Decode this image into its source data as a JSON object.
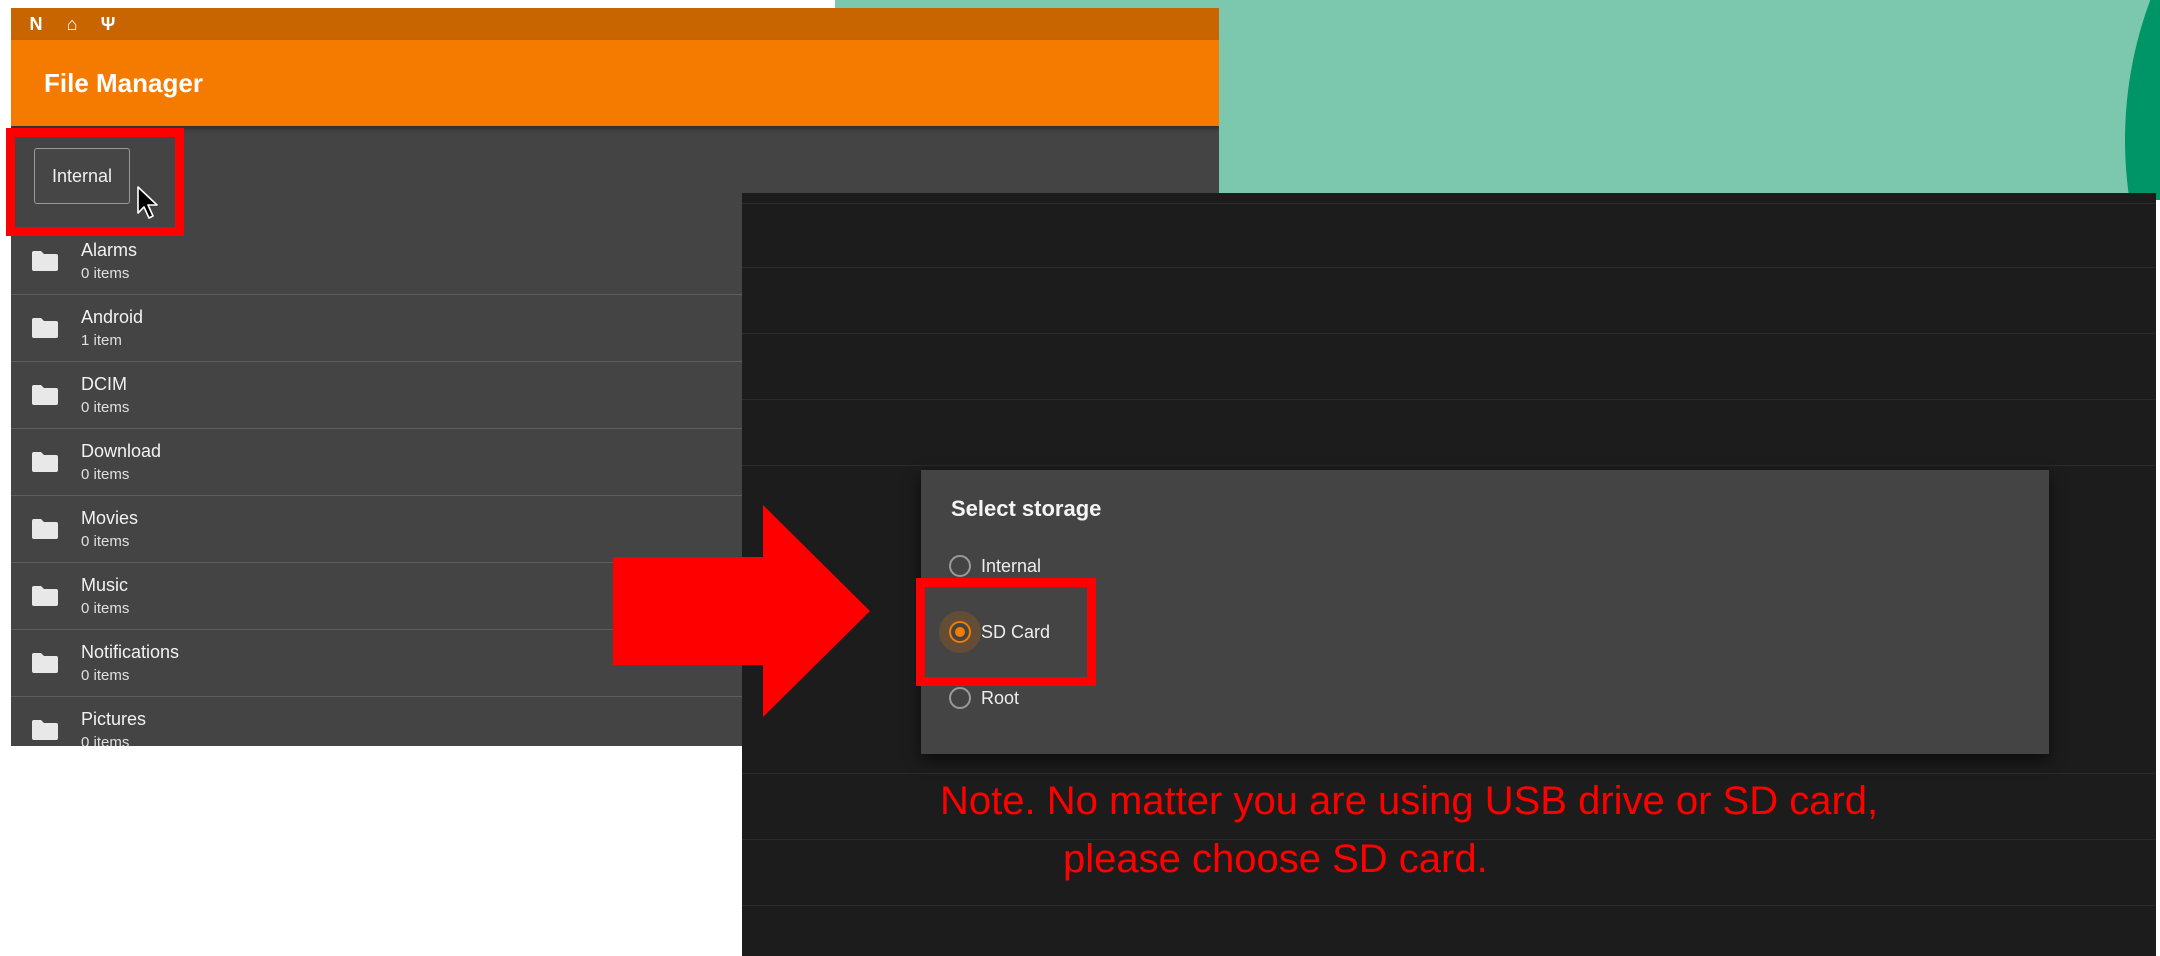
{
  "colors": {
    "statusbar": "#c96500",
    "appbar": "#f57b00",
    "panel": "#444444",
    "highlight": "#ff0000",
    "radio_accent": "#f57b00",
    "bg_light_green": "#7bc8ae",
    "bg_dark_green": "#009566"
  },
  "statusbar": {
    "icons": [
      "n-logo-icon",
      "home-icon",
      "usb-icon"
    ]
  },
  "file_manager": {
    "title": "File Manager",
    "storage_button": "Internal",
    "items": [
      {
        "name": "Alarms",
        "count": "0 items"
      },
      {
        "name": "Android",
        "count": "1 item"
      },
      {
        "name": "DCIM",
        "count": "0 items"
      },
      {
        "name": "Download",
        "count": "0 items"
      },
      {
        "name": "Movies",
        "count": "0 items"
      },
      {
        "name": "Music",
        "count": "0 items"
      },
      {
        "name": "Notifications",
        "count": "0 items"
      },
      {
        "name": "Pictures",
        "count": "0 items"
      }
    ]
  },
  "dialog": {
    "title": "Select storage",
    "options": [
      {
        "label": "Internal",
        "selected": false
      },
      {
        "label": "SD Card",
        "selected": true
      },
      {
        "label": "Root",
        "selected": false
      }
    ]
  },
  "note": {
    "line1": "Note. No matter you are using USB drive or SD card,",
    "line2": "please choose SD card."
  }
}
